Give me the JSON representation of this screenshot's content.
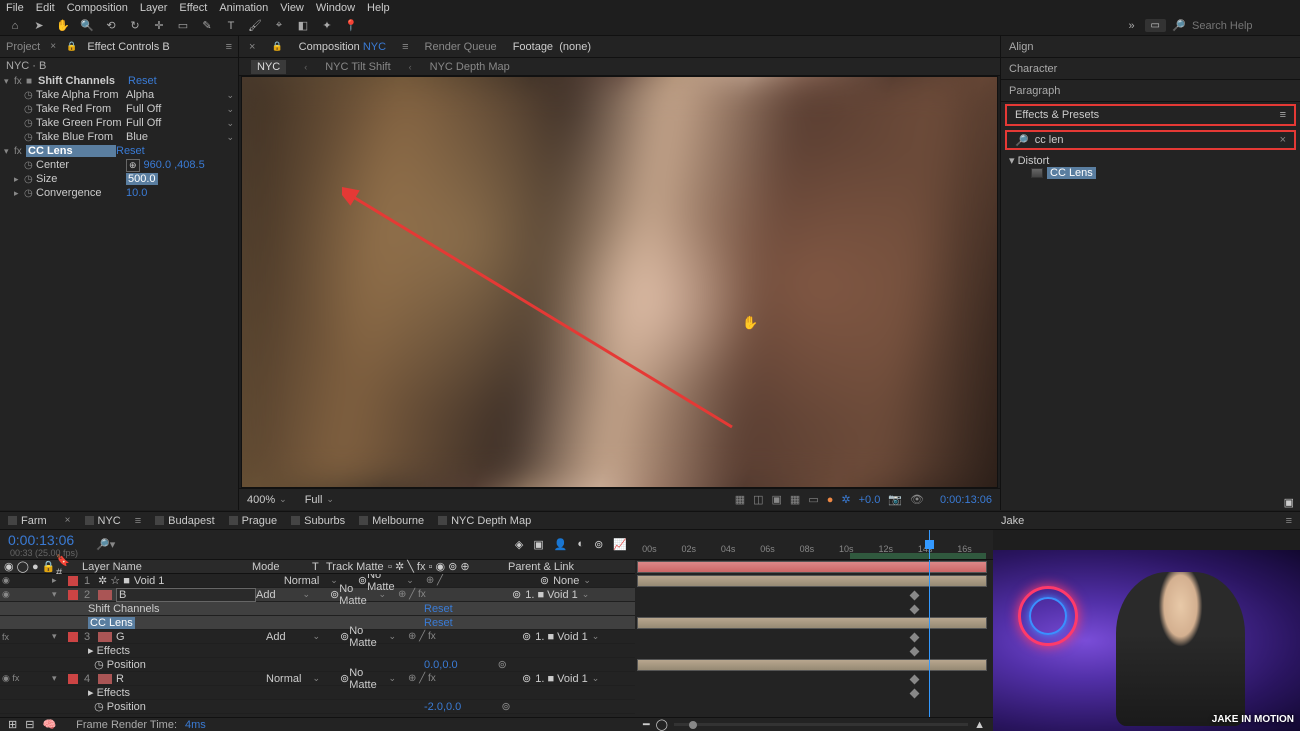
{
  "menu": [
    "File",
    "Edit",
    "Composition",
    "Layer",
    "Effect",
    "Animation",
    "View",
    "Window",
    "Help"
  ],
  "search_help": "Search Help",
  "tabs": {
    "project": "Project",
    "ec": "Effect Controls",
    "ec_target": "B"
  },
  "ec_head": "NYC · B",
  "effects": {
    "shift_channels": {
      "name": "Shift Channels",
      "reset": "Reset",
      "alpha_label": "Take Alpha From",
      "alpha_val": "Alpha",
      "red_label": "Take Red From",
      "red_val": "Full Off",
      "green_label": "Take Green From",
      "green_val": "Full Off",
      "blue_label": "Take Blue From",
      "blue_val": "Blue"
    },
    "cc_lens": {
      "name": "CC Lens",
      "reset": "Reset",
      "center_label": "Center",
      "center_val": "960.0 ,408.5",
      "size_label": "Size",
      "size_val": "500.0",
      "conv_label": "Convergence",
      "conv_val": "10.0"
    }
  },
  "center": {
    "comp_tab": "Composition",
    "comp_name": "NYC",
    "render_queue": "Render Queue",
    "footage": "Footage",
    "footage_none": "(none)",
    "crumbs": [
      "NYC",
      "NYC Tilt Shift",
      "NYC Depth Map"
    ]
  },
  "viewer": {
    "zoom": "400%",
    "res": "Full",
    "exposure": "+0.0",
    "timecode": "0:00:13:06"
  },
  "right": {
    "align": "Align",
    "character": "Character",
    "paragraph": "Paragraph",
    "ep": "Effects & Presets",
    "search": "cc len",
    "folder": "Distort",
    "item": "CC Lens"
  },
  "tl": {
    "tabs": [
      "Farm",
      "NYC",
      "Budapest",
      "Prague",
      "Suburbs",
      "Melbourne",
      "NYC Depth Map"
    ],
    "active_tab": 1,
    "timecode": "0:00:13:06",
    "subtc": "00:33 (25.00 fps)",
    "cols": {
      "layer_name": "Layer Name",
      "mode": "Mode",
      "t": "T",
      "matte": "Track Matte",
      "parent": "Parent & Link"
    },
    "layers": [
      {
        "num": "1",
        "name": "Void 1",
        "mode": "Normal",
        "matte": "No Matte",
        "parent": "None",
        "color": "#c44"
      },
      {
        "num": "2",
        "name": "B",
        "mode": "Add",
        "matte": "No Matte",
        "parent": "1.  ■ Void 1",
        "color": "#c44",
        "selected": true
      },
      {
        "num": "3",
        "name": "G",
        "mode": "Add",
        "matte": "No Matte",
        "parent": "1.  ■ Void 1",
        "color": "#c44"
      },
      {
        "num": "4",
        "name": "R",
        "mode": "Normal",
        "matte": "No Matte",
        "parent": "1.  ■ Void 1",
        "color": "#c44"
      }
    ],
    "sub": {
      "shift_channels": "Shift Channels",
      "cc_lens": "CC Lens",
      "effects": "Effects",
      "position": "Position",
      "reset": "Reset",
      "pos1": "0.0,0.0",
      "pos2": "-2.0,0.0"
    },
    "footer": {
      "frt_label": "Frame Render Time:",
      "frt_val": "4ms"
    },
    "ruler": [
      "00s",
      "02s",
      "04s",
      "06s",
      "08s",
      "10s",
      "12s",
      "14s",
      "16s"
    ]
  },
  "info": {
    "name": "Jake"
  },
  "watermark": "JAKE IN\nMOTION"
}
